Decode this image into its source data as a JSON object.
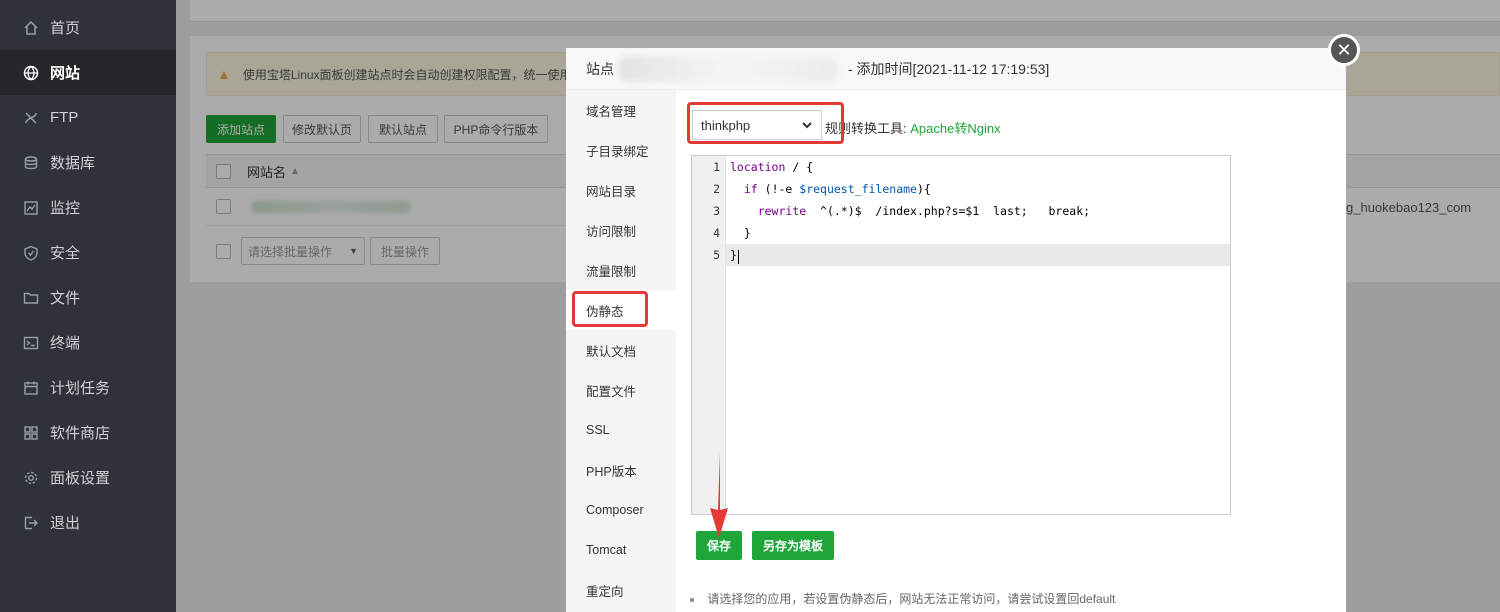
{
  "sidebar": {
    "items": [
      {
        "label": "首页",
        "icon": "home-icon",
        "active": false
      },
      {
        "label": "网站",
        "icon": "globe-icon",
        "active": true
      },
      {
        "label": "FTP",
        "icon": "ftp-icon",
        "active": false
      },
      {
        "label": "数据库",
        "icon": "database-icon",
        "active": false
      },
      {
        "label": "监控",
        "icon": "monitor-icon",
        "active": false
      },
      {
        "label": "安全",
        "icon": "shield-icon",
        "active": false
      },
      {
        "label": "文件",
        "icon": "folder-icon",
        "active": false
      },
      {
        "label": "终端",
        "icon": "terminal-icon",
        "active": false
      },
      {
        "label": "计划任务",
        "icon": "calendar-icon",
        "active": false
      },
      {
        "label": "软件商店",
        "icon": "grid-icon",
        "active": false
      },
      {
        "label": "面板设置",
        "icon": "gear-icon",
        "active": false
      },
      {
        "label": "退出",
        "icon": "logout-icon",
        "active": false
      }
    ]
  },
  "background": {
    "warning_text": "使用宝塔Linux面板创建站点时会自动创建权限配置，统一使用",
    "buttons": {
      "add_site": "添加站点",
      "modify_default_page": "修改默认页",
      "default_site": "默认站点",
      "php_cli_version": "PHP命令行版本"
    },
    "table": {
      "col_site_name": "网站名",
      "domain_suffix": "g_huokebao123_com"
    },
    "batch": {
      "select_placeholder": "请选择批量操作",
      "batch_button": "批量操作"
    }
  },
  "modal": {
    "title_prefix": "站点",
    "title_suffix": "- 添加时间[2021-11-12 17:19:53]",
    "side_items": [
      "域名管理",
      "子目录绑定",
      "网站目录",
      "访问限制",
      "流量限制",
      "伪静态",
      "默认文档",
      "配置文件",
      "SSL",
      "PHP版本",
      "Composer",
      "Tomcat",
      "重定向"
    ],
    "active_side_item": "伪静态",
    "rewrite_select": "thinkphp",
    "tool_label": "规则转换工具:",
    "tool_link": "Apache转Nginx",
    "editor": {
      "line_numbers": [
        "1",
        "2",
        "3",
        "4",
        "5"
      ],
      "lines": [
        "location / {",
        "  if (!-e $request_filename){",
        "    rewrite  ^(.*)$  /index.php?s=$1  last;   break;",
        "  }",
        "}"
      ]
    },
    "save_label": "保存",
    "save_as_template_label": "另存为模板",
    "tip": "请选择您的应用，若设置伪静态后，网站无法正常访问，请尝试设置回default"
  },
  "colors": {
    "accent_green": "#20a53a",
    "sidebar_bg": "#2f3238",
    "annotation_red": "#e53935"
  }
}
